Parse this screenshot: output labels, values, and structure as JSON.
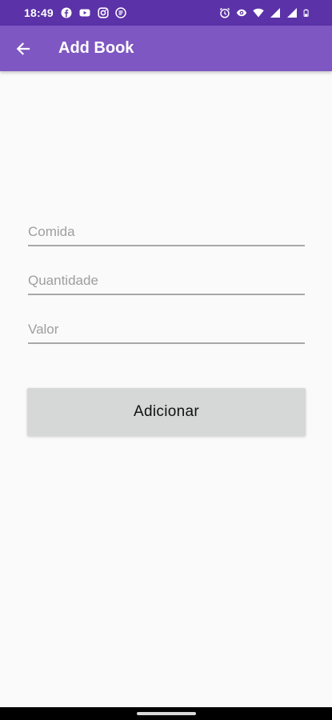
{
  "status_bar": {
    "time": "18:49",
    "left_icons": [
      "facebook-icon",
      "youtube-icon",
      "instagram-icon",
      "notification-app-icon"
    ],
    "right_icons": [
      "alarm-icon",
      "eye-icon",
      "wifi-icon",
      "signal-icon",
      "signal-icon",
      "battery-icon"
    ]
  },
  "app_bar": {
    "title": "Add Book",
    "back_icon": "arrow-left-icon"
  },
  "form": {
    "comida_placeholder": "Comida",
    "quantidade_placeholder": "Quantidade",
    "valor_placeholder": "Valor",
    "submit_label": "Adicionar"
  },
  "colors": {
    "status_bar": "#5b32a8",
    "app_bar": "#7e57c2",
    "background": "#fafafa",
    "button": "#d6d7d7"
  }
}
